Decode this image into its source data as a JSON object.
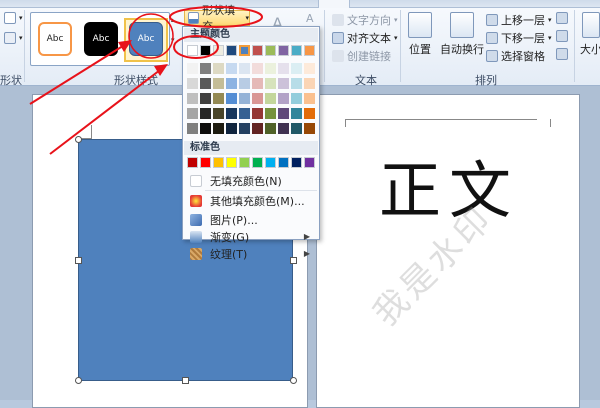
{
  "ribbon": {
    "groups": {
      "shape_styles_label": "形状样式",
      "arrange_label": "排列",
      "text_label": "文本",
      "size_label": "大小",
      "insert_shape_label_fragment": "形状"
    },
    "style_samples": [
      "Abc",
      "Abc",
      "Abc"
    ],
    "fill_button_label": "形状填充",
    "text_group": {
      "direction": "文字方向",
      "align": "对齐文本",
      "link": "创建链接"
    },
    "arrange_group": {
      "position": "位置",
      "wrap": "自动换行",
      "bring_forward": "上移一层",
      "send_backward": "下移一层",
      "selection_pane": "选择窗格"
    }
  },
  "dropdown": {
    "theme_colors_title": "主题颜色",
    "standard_colors_title": "标准色",
    "theme_colors": [
      "#ffffff",
      "#000000",
      "#eeece1",
      "#1f497d",
      "#4f81bd",
      "#c0504d",
      "#9bbb59",
      "#8064a2",
      "#4bacc6",
      "#f79646"
    ],
    "theme_shades": [
      [
        "#f2f2f2",
        "#7f7f7f",
        "#ddd9c3",
        "#c6d9f0",
        "#dbe5f1",
        "#f2dcdb",
        "#ebf1dd",
        "#e5e0ec",
        "#dbeef3",
        "#fdeada"
      ],
      [
        "#d8d8d8",
        "#595959",
        "#c4bd97",
        "#8db3e2",
        "#b8cce4",
        "#e5b9b7",
        "#d7e3bc",
        "#ccc1d9",
        "#b7dde8",
        "#fbd5b5"
      ],
      [
        "#bfbfbf",
        "#3f3f3f",
        "#938953",
        "#548dd4",
        "#95b3d7",
        "#d99694",
        "#c3d69b",
        "#b2a2c7",
        "#92cddc",
        "#fac08f"
      ],
      [
        "#a5a5a5",
        "#262626",
        "#494429",
        "#17365d",
        "#366092",
        "#953734",
        "#76923c",
        "#5f497a",
        "#31859b",
        "#e36c09"
      ],
      [
        "#7f7f7f",
        "#0c0c0c",
        "#1d1b10",
        "#0f243e",
        "#244061",
        "#632423",
        "#4f6128",
        "#3f3151",
        "#205867",
        "#974806"
      ]
    ],
    "standard_colors": [
      "#c00000",
      "#ff0000",
      "#ffc000",
      "#ffff00",
      "#92d050",
      "#00b050",
      "#00b0f0",
      "#0070c0",
      "#002060",
      "#7030a0"
    ],
    "menu": {
      "no_fill": "无填充颜色(N)",
      "more_colors": "其他填充颜色(M)...",
      "picture": "图片(P)...",
      "gradient": "渐变(G)",
      "texture": "纹理(T)"
    }
  },
  "document": {
    "heading_text": "正文",
    "watermark_text": "我是水印",
    "shape_color": "#4f81bd"
  },
  "annotation_color": "#e8121a"
}
